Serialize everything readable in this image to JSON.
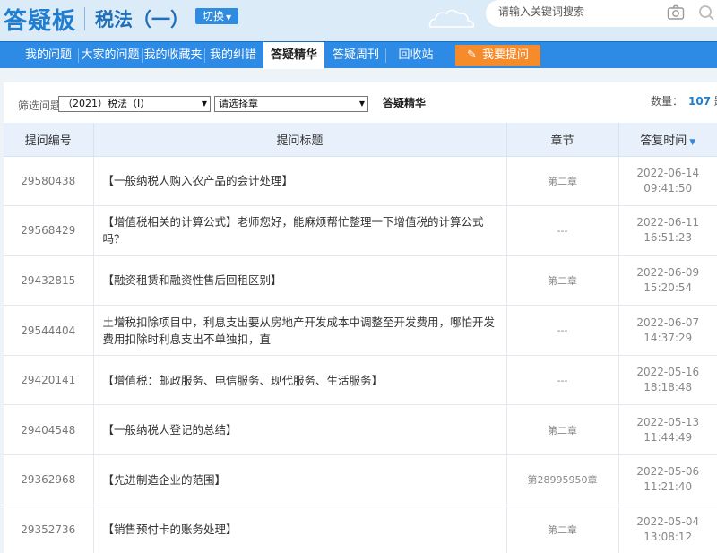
{
  "header": {
    "brand": "答疑板",
    "subject": "税法（一）",
    "switch_label": "切换",
    "search_placeholder": "请输入关键词搜索"
  },
  "nav": {
    "items": [
      "我的问题",
      "大家的问题",
      "我的收藏夹",
      "我的纠错",
      "答疑精华",
      "答疑周刊",
      "回收站"
    ],
    "active": "答疑精华",
    "ask_label": "我要提问"
  },
  "filter": {
    "label": "筛选问题",
    "course_value": "（2021）税法（Ⅰ）",
    "chapter_value": "请选择章",
    "section_title": "答疑精华",
    "count_label": "数量：",
    "count_value": "107",
    "count_unit": "题"
  },
  "table": {
    "headers": [
      "提问编号",
      "提问标题",
      "章节",
      "答复时间"
    ],
    "rows": [
      {
        "id": "29580438",
        "title": "【一般纳税人购入农产品的会计处理】",
        "chapter": "第二章",
        "date": "2022-06-14",
        "time": "09:41:50"
      },
      {
        "id": "29568429",
        "title": "【增值税相关的计算公式】老师您好，能麻烦帮忙整理一下增值税的计算公式吗？",
        "chapter": "---",
        "date": "2022-06-11",
        "time": "16:51:23"
      },
      {
        "id": "29432815",
        "title": "【融资租赁和融资性售后回租区别】",
        "chapter": "第二章",
        "date": "2022-06-09",
        "time": "15:20:54"
      },
      {
        "id": "29544404",
        "title": "土增税扣除项目中，利息支出要从房地产开发成本中调整至开发费用，哪怕开发费用扣除时利息支出不单独扣，直",
        "chapter": "---",
        "date": "2022-06-07",
        "time": "14:37:29"
      },
      {
        "id": "29420141",
        "title": "【增值税：邮政服务、电信服务、现代服务、生活服务】",
        "chapter": "---",
        "date": "2022-05-16",
        "time": "18:18:48"
      },
      {
        "id": "29404548",
        "title": "【一般纳税人登记的总结】",
        "chapter": "第二章",
        "date": "2022-05-13",
        "time": "11:44:49"
      },
      {
        "id": "29362968",
        "title": "【先进制造企业的范围】",
        "chapter": "第28995950章",
        "date": "2022-05-06",
        "time": "11:21:40"
      },
      {
        "id": "29352736",
        "title": "【销售预付卡的账务处理】",
        "chapter": "第二章",
        "date": "2022-05-04",
        "time": "13:08:12"
      }
    ]
  },
  "colors": {
    "brand": "#1f7ed0",
    "nav": "#2d8ae5",
    "accent": "#f58b2a"
  },
  "icons": [
    "camera-icon",
    "search-icon",
    "pencil-icon",
    "sort-desc-icon"
  ]
}
